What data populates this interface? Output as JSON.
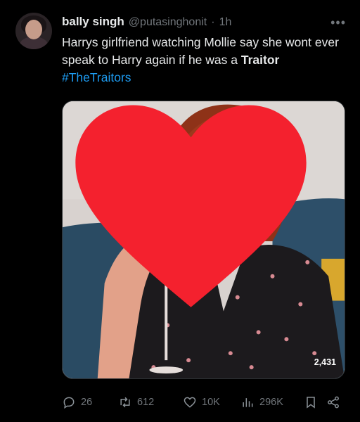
{
  "author": {
    "display_name": "bally singh",
    "handle": "@putasinghonit",
    "separator": "·",
    "time": "1h"
  },
  "tweet": {
    "text_before": "Harrys girlfriend watching Mollie say she wont ever speak to Harry again if he was a ",
    "text_bold": "Traitor",
    "hashtag": "#TheTraitors"
  },
  "media": {
    "like_count": "2,431"
  },
  "actions": {
    "reply": "26",
    "retweet": "612",
    "like": "10K",
    "views": "296K"
  },
  "icons": {
    "more": "more-dots-icon",
    "reply": "reply-icon",
    "retweet": "retweet-icon",
    "like": "heart-icon",
    "views": "views-icon",
    "bookmark": "bookmark-icon",
    "share": "share-icon"
  },
  "colors": {
    "background": "#000000",
    "text": "#e7e9ea",
    "muted": "#71767b",
    "link": "#1d9bf0",
    "heart": "#f91880"
  }
}
